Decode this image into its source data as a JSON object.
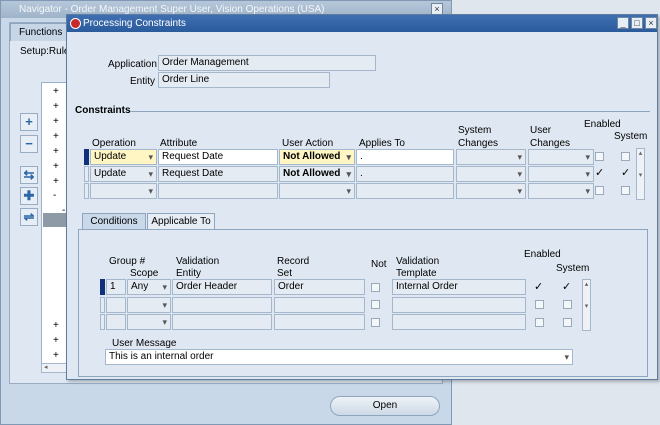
{
  "navigator": {
    "title": "Navigator - Order Management Super User, Vision Operations (USA)",
    "tab_label": "Functions",
    "setup_label": "Setup:Rule",
    "tree_markers": [
      "+",
      "+",
      "+",
      "+",
      "+",
      "+",
      "+",
      "-",
      "-",
      "+",
      "+",
      "+"
    ],
    "open_button": "Open",
    "side_buttons": [
      "+",
      "−",
      "⇆",
      "✚",
      "⇌"
    ]
  },
  "window": {
    "title": "Processing Constraints",
    "buttons": [
      "_",
      "□",
      "×"
    ]
  },
  "header": {
    "application_label": "Application",
    "application_value": "Order Management",
    "entity_label": "Entity",
    "entity_value": "Order Line"
  },
  "constraints": {
    "section_title": "Constraints",
    "columns": {
      "operation": "Operation",
      "attribute": "Attribute",
      "user_action": "User Action",
      "applies_to": "Applies To",
      "system_changes_1": "System",
      "system_changes_2": "Changes",
      "user_changes_1": "User",
      "user_changes_2": "Changes",
      "enabled": "Enabled",
      "system": "System"
    },
    "rows": [
      {
        "operation": "Update",
        "attribute": "Request Date",
        "user_action": "Not Allowed",
        "applies_to": ".",
        "system_changes": "",
        "user_changes": "",
        "enabled": false,
        "system": false
      },
      {
        "operation": "Update",
        "attribute": "Request Date",
        "user_action": "Not Allowed",
        "applies_to": ".",
        "system_changes": "",
        "user_changes": "",
        "enabled": true,
        "system": true
      },
      {
        "operation": "",
        "attribute": "",
        "user_action": "",
        "applies_to": "",
        "system_changes": "",
        "user_changes": "",
        "enabled": false,
        "system": false
      }
    ]
  },
  "tabs": {
    "conditions": "Conditions",
    "applicable_to": "Applicable To"
  },
  "conditions": {
    "columns": {
      "group_1": "Group #",
      "scope": "Scope",
      "validation_entity_1": "Validation",
      "validation_entity_2": "Entity",
      "record_set_1": "Record",
      "record_set_2": "Set",
      "not": "Not",
      "validation_template_1": "Validation",
      "validation_template_2": "Template",
      "enabled": "Enabled",
      "system": "System"
    },
    "rows": [
      {
        "group": "1",
        "scope": "Any",
        "validation_entity": "Order Header",
        "record_set": "Order",
        "not": false,
        "validation_template": "Internal Order",
        "enabled": true,
        "system": true
      },
      {
        "group": "",
        "scope": "",
        "validation_entity": "",
        "record_set": "",
        "not": false,
        "validation_template": "",
        "enabled": false,
        "system": false
      },
      {
        "group": "",
        "scope": "",
        "validation_entity": "",
        "record_set": "",
        "not": false,
        "validation_template": "",
        "enabled": false,
        "system": false
      }
    ],
    "user_message_label": "User Message",
    "user_message_value": "This is an internal order"
  },
  "icons": {
    "window_icon": "oracle-icon",
    "dropdown": "chevron-down-icon",
    "check": "✓"
  }
}
